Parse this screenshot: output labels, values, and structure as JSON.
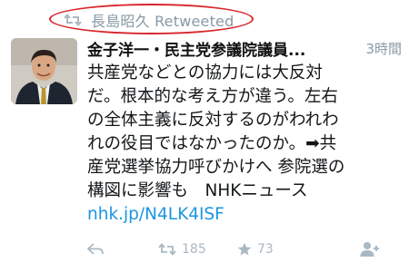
{
  "retweet_header": {
    "text": "長島昭久 Retweeted",
    "icon": "retweet-icon"
  },
  "tweet": {
    "author": "金子洋一・民主党参議院議員...",
    "time": "3時間",
    "lines": [
      "共産党などとの協力には大反対",
      "だ。根本的な考え方が違う。左右",
      "の全体主義に反対するのがわれわ",
      "れの役目ではなかったのか。➡共",
      "産党選挙協力呼びかけへ 参院選の",
      "構図に影響も　NHKニュース"
    ],
    "link": "nhk.jp/N4LK4ISF"
  },
  "actions": {
    "reply_icon": "reply-icon",
    "retweet_count": "185",
    "like_count": "73",
    "follow_icon": "follow-icon"
  },
  "colors": {
    "link": "#1b95e0",
    "muted": "#8899a6",
    "highlight": "#d8262b"
  }
}
